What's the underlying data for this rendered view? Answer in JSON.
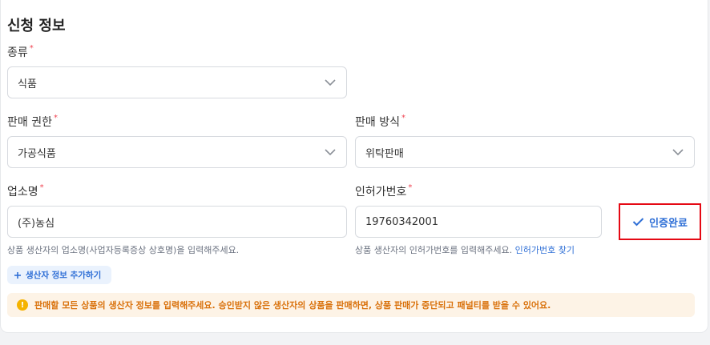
{
  "section": {
    "title": "신청 정보"
  },
  "type_field": {
    "label": "종류",
    "value": "식품"
  },
  "sales_permission": {
    "label": "판매 권한",
    "value": "가공식품"
  },
  "sales_method": {
    "label": "판매 방식",
    "value": "위탁판매"
  },
  "business_name": {
    "label": "업소명",
    "value": "(주)농심",
    "helper": "상품 생산자의 업소명(사업자등록증상 상호명)을 입력해주세요."
  },
  "license_number": {
    "label": "인허가번호",
    "value": "19760342001",
    "helper": "상품 생산자의 인허가번호를 입력해주세요.",
    "helper_link": "인허가번호 찾기",
    "verify_label": "인증완료"
  },
  "add_producer": {
    "label": "생산자 정보 추가하기",
    "icon": "plus-icon"
  },
  "notice": {
    "text": "판매할 모든 상품의 생산자 정보를 입력해주세요. 승인받지 않은 생산자의 상품을 판매하면, 상품 판매가 중단되고 패널티를 받을 수 있어요.",
    "icon": "warning-icon"
  },
  "required_mark": "*",
  "colors": {
    "accent": "#2f6fd6",
    "required": "#f04452",
    "highlight_box": "#e50914",
    "notice_bg": "#fdf3e6",
    "notice_text": "#d9710b"
  }
}
